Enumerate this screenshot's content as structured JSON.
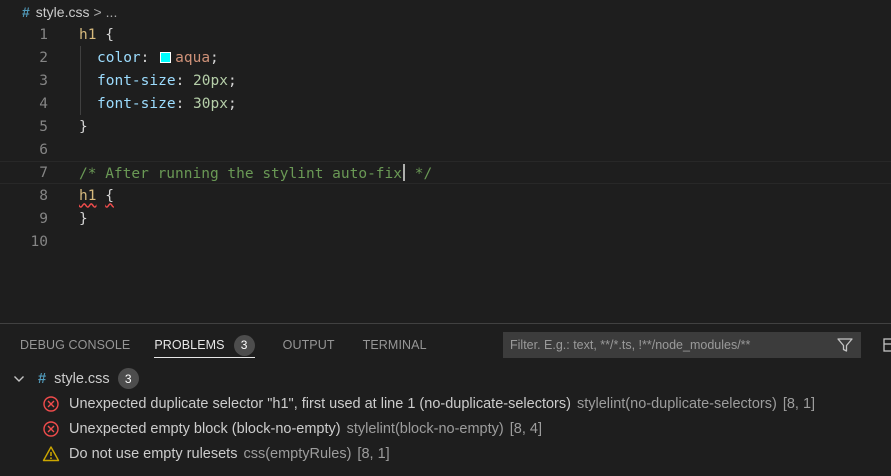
{
  "breadcrumb": {
    "icon": "#",
    "file": "style.css",
    "separator": ">",
    "more": "..."
  },
  "editor": {
    "line_numbers": [
      "1",
      "2",
      "3",
      "4",
      "5",
      "6",
      "7",
      "8",
      "9",
      "10"
    ],
    "line1": {
      "selector": "h1",
      "brace": "{"
    },
    "line2": {
      "prop": "color",
      "colon": ":",
      "value": "aqua",
      "semi": ";"
    },
    "line3": {
      "prop": "font-size",
      "colon": ":",
      "value": "20px",
      "semi": ";"
    },
    "line4": {
      "prop": "font-size",
      "colon": ":",
      "value": "30px",
      "semi": ";"
    },
    "line5": {
      "brace": "}"
    },
    "line7": {
      "comment_before": "/* After running the stylint auto-fix",
      "comment_after": " */"
    },
    "line8": {
      "selector": "h1",
      "brace": "{"
    },
    "line9": {
      "brace": "}"
    }
  },
  "panel": {
    "tabs": [
      {
        "label": "DEBUG CONSOLE"
      },
      {
        "label": "PROBLEMS",
        "count": "3"
      },
      {
        "label": "OUTPUT"
      },
      {
        "label": "TERMINAL"
      }
    ],
    "filter_placeholder": "Filter. E.g.: text, **/*.ts, !**/node_modules/**",
    "file": {
      "icon": "#",
      "name": "style.css",
      "count": "3"
    },
    "problems": [
      {
        "severity": "error",
        "message": "Unexpected duplicate selector \"h1\", first used at line 1 (no-duplicate-selectors)",
        "source": "stylelint(no-duplicate-selectors)",
        "location": "[8, 1]"
      },
      {
        "severity": "error",
        "message": "Unexpected empty block (block-no-empty)",
        "source": "stylelint(block-no-empty)",
        "location": "[8, 4]"
      },
      {
        "severity": "warning",
        "message": "Do not use empty rulesets",
        "source": "css(emptyRules)",
        "location": "[8, 1]"
      }
    ]
  },
  "colors": {
    "error": "#f14c4c",
    "warning": "#cca700",
    "swatch": "#00ffff",
    "accent": "#519aba"
  }
}
